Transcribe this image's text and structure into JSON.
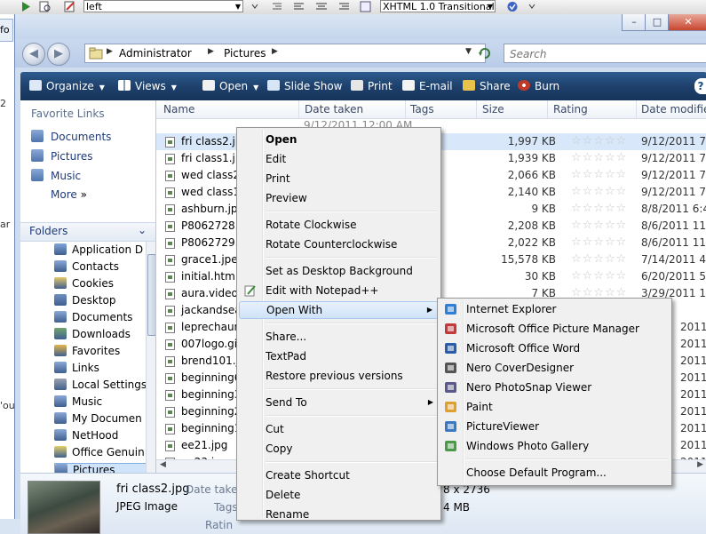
{
  "bg_toolbar": {
    "style_combo": "left",
    "doctype_combo": "XHTML 1.0 Transitional"
  },
  "bg_left": {
    "tab": "fo",
    "fragments": [
      "2",
      "ar",
      "'ou"
    ]
  },
  "window_controls": {
    "minimize": "–",
    "maximize": "□",
    "close": "✕"
  },
  "address": {
    "crumbs": [
      "Administrator",
      "Pictures"
    ],
    "search_placeholder": "Search"
  },
  "toolbar": {
    "organize": "Organize",
    "views": "Views",
    "open": "Open",
    "slideshow": "Slide Show",
    "print": "Print",
    "email": "E-mail",
    "share": "Share",
    "burn": "Burn",
    "help": "?"
  },
  "nav": {
    "favorite_links": "Favorite Links",
    "favorites": [
      "Documents",
      "Pictures",
      "Music"
    ],
    "more": "More",
    "more_arrow": "»",
    "folders": "Folders",
    "tree": [
      "Application D",
      "Contacts",
      "Cookies",
      "Desktop",
      "Documents",
      "Downloads",
      "Favorites",
      "Links",
      "Local Settings",
      "Music",
      "My Documen",
      "NetHood",
      "Office Genuin",
      "Pictures",
      "PrintHood"
    ]
  },
  "columns": {
    "name": "Name",
    "date": "Date taken",
    "tags": "Tags",
    "size": "Size",
    "rating": "Rating",
    "modified": "Date modifie"
  },
  "files": [
    {
      "name": "fri class2.jpg",
      "size": "1,997 KB",
      "modified": "9/12/2011 7:5"
    },
    {
      "name": "fri class1.jpg",
      "size": "1,939 KB",
      "modified": "9/12/2011 7:5"
    },
    {
      "name": "wed class2.jpg",
      "size": "2,066 KB",
      "modified": "9/12/2011 7:5"
    },
    {
      "name": "wed class1.jpg",
      "size": "2,140 KB",
      "modified": "9/12/2011 7:5"
    },
    {
      "name": "ashburn.jpg",
      "size": "9 KB",
      "modified": "8/8/2011 6:46"
    },
    {
      "name": "P8062728.JPG",
      "size": "2,208 KB",
      "modified": "8/6/2011 11:5"
    },
    {
      "name": "P8062729.JPG",
      "size": "2,022 KB",
      "modified": "8/6/2011 11:5"
    },
    {
      "name": "grace1.jpeg",
      "size": "15,578 KB",
      "modified": "7/14/2011 4:5"
    },
    {
      "name": "initial.htm",
      "size": "30 KB",
      "modified": "6/20/2011 5:1"
    },
    {
      "name": "aura.video.1",
      "size": "7 KB",
      "modified": "3/29/2011 10:"
    },
    {
      "name": "jackandsear",
      "size": "",
      "modified": ""
    },
    {
      "name": "leprechaun(",
      "size": "",
      "modified": "2011 6:"
    },
    {
      "name": "007logo.gif",
      "size": "",
      "modified": "2011 4:0"
    },
    {
      "name": "brend101.jp",
      "size": "",
      "modified": "2011 1:"
    },
    {
      "name": "beginning6",
      "size": "",
      "modified": "2011 1:"
    },
    {
      "name": "beginning3",
      "size": "",
      "modified": "2011 1:"
    },
    {
      "name": "beginning2",
      "size": "",
      "modified": "2011 1:"
    },
    {
      "name": "beginning1",
      "size": "",
      "modified": "2011 1:0"
    },
    {
      "name": "ee21.jpg",
      "size": "",
      "modified": "2011 1:"
    },
    {
      "name": "ee23.jpg",
      "size": "",
      "modified": "2011 1:"
    }
  ],
  "selected_date_fragment": "9/12/2011 12:00 AM",
  "stars": "☆☆☆☆☆",
  "details": {
    "filename": "fri class2.jpg",
    "type": "JPEG Image",
    "date_label": "Date taken",
    "tags_label": "Tags",
    "rating_label": "Ratin",
    "dimensions_fragment": "8 x 2736",
    "size_fragment": "4 MB"
  },
  "context_menu": {
    "items": [
      "Open",
      "Edit",
      "Print",
      "Preview",
      "Rotate Clockwise",
      "Rotate Counterclockwise",
      "Set as Desktop Background",
      "Edit with Notepad++",
      "Open With",
      "Share...",
      "TextPad",
      "Restore previous versions",
      "Send To",
      "Cut",
      "Copy",
      "Create Shortcut",
      "Delete",
      "Rename"
    ]
  },
  "open_with_menu": {
    "items": [
      "Internet Explorer",
      "Microsoft Office Picture Manager",
      "Microsoft Office Word",
      "Nero CoverDesigner",
      "Nero PhotoSnap Viewer",
      "Paint",
      "PictureViewer",
      "Windows Photo Gallery",
      "Choose Default Program..."
    ]
  }
}
